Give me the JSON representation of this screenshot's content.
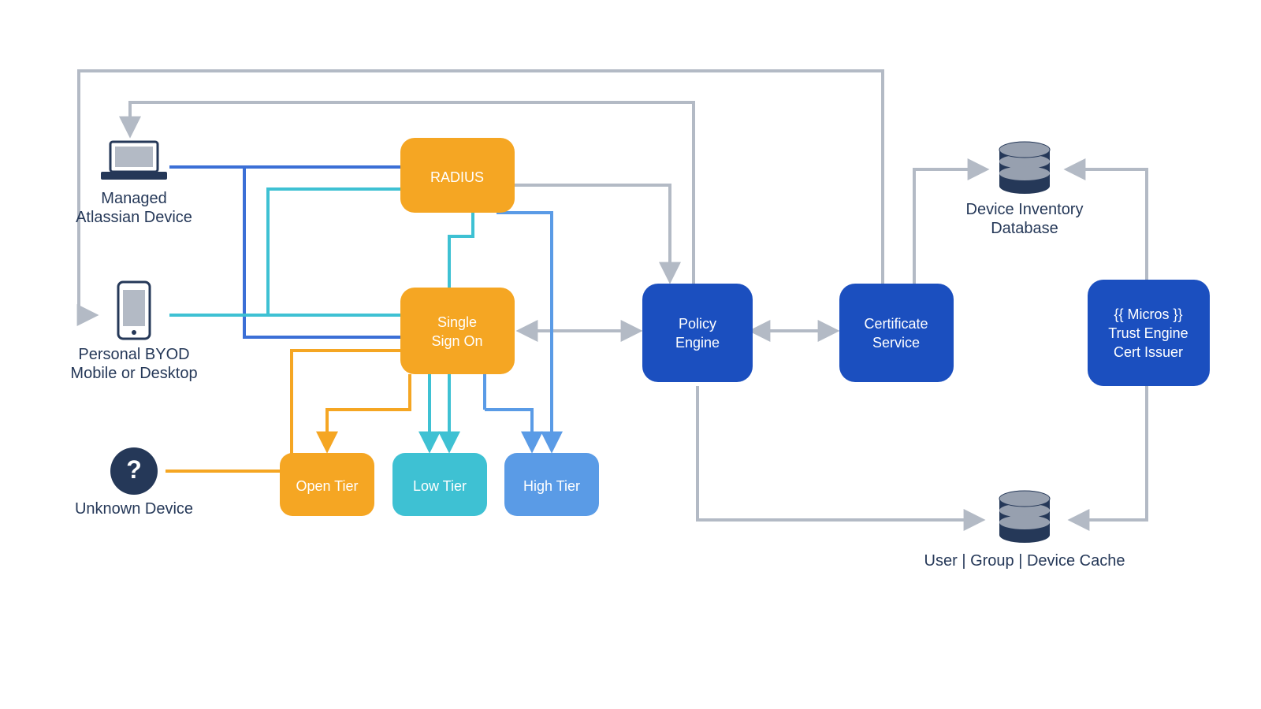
{
  "devices": {
    "managed": {
      "line1": "Managed",
      "line2": "Atlassian Device"
    },
    "byod": {
      "line1": "Personal BYOD",
      "line2": "Mobile or Desktop"
    },
    "unknown": {
      "line1": "Unknown Device"
    }
  },
  "services": {
    "radius": "RADIUS",
    "sso_l1": "Single",
    "sso_l2": "Sign On",
    "policy_l1": "Policy",
    "policy_l2": "Engine",
    "cert_l1": "Certificate",
    "cert_l2": "Service",
    "micros_l1": "{{ Micros }}",
    "micros_l2": "Trust Engine",
    "micros_l3": "Cert Issuer"
  },
  "tiers": {
    "open": "Open Tier",
    "low": "Low Tier",
    "high": "High Tier"
  },
  "db": {
    "inventory_l1": "Device Inventory",
    "inventory_l2": "Database",
    "cache": "User | Group | Device Cache"
  },
  "colors": {
    "orange": "#F5A623",
    "teal": "#3EC1D3",
    "skyblue": "#5A9BE6",
    "darkblue": "#1B4FBF",
    "navy": "#253858",
    "grey": "#B3BAC5",
    "darkline": "#4C5C7A",
    "blueline": "#3B6FD6",
    "tealline": "#3EC1D3"
  }
}
